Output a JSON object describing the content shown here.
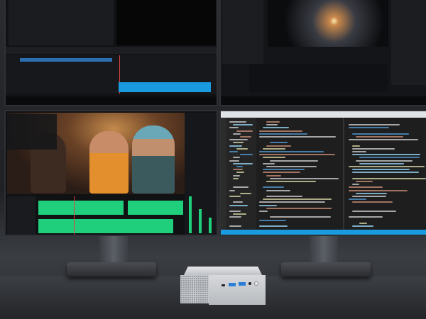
{
  "scene": {
    "subject": "mini-pc",
    "colors": {
      "accent_blue": "#1a9be0",
      "audio_green": "#1fcf7c",
      "chassis": "#c9ccd0",
      "usb_port": "#2d7fd6"
    }
  }
}
